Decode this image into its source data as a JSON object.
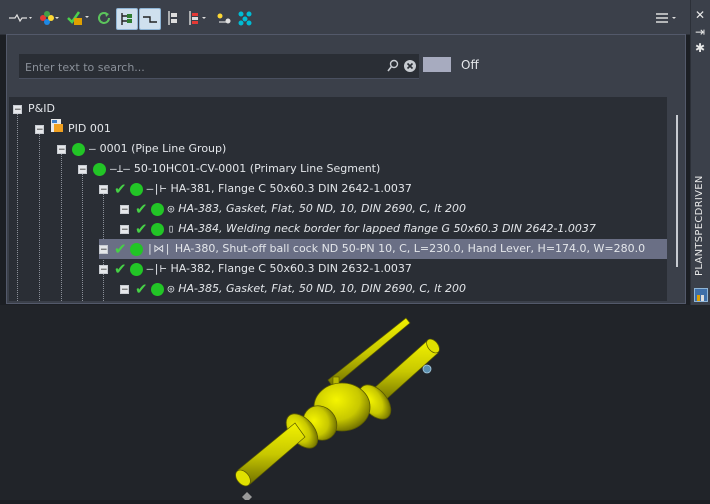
{
  "toolbar": {
    "icons": [
      "line-dropdown-icon",
      "color-dropdown-icon",
      "check-filter-icon",
      "refresh-icon",
      "tree-view-icon",
      "line-segment-icon",
      "hierarchy-icon",
      "hierarchy-dropdown-icon",
      "move-icon",
      "connect-icon",
      "menu-icon"
    ]
  },
  "side_panel": {
    "title": "PLANTSPECDRIVEN",
    "glyphs": [
      "✕",
      "⇥",
      "✱"
    ]
  },
  "search": {
    "placeholder": "Enter text to search...",
    "value": ""
  },
  "filter_toggle": {
    "label": "Off",
    "state": false
  },
  "tree": {
    "rows": [
      {
        "label": "P&ID"
      },
      {
        "label": "PID 001"
      },
      {
        "label": "0001 (Pipe Line Group)"
      },
      {
        "label": "50-10HC01-CV-0001 (Primary Line Segment)"
      },
      {
        "label": "HA-381, Flange C 50x60.3 DIN 2642-1.0037"
      },
      {
        "label": "HA-383, Gasket, Flat, 50 ND, 10, DIN 2690, C, lt 200"
      },
      {
        "label": "HA-384, Welding neck border for lapped flange G 50x60.3 DIN 2642-1.0037"
      },
      {
        "label": "HA-380, Shut-off ball cock ND 50-PN 10, C, L=230.0, Hand Lever, H=174.0, W=280.0"
      },
      {
        "label": "HA-382, Flange C 50x60.3 DIN 2632-1.0037"
      },
      {
        "label": "HA-385, Gasket, Flat, 50 ND, 10, DIN 2690, C, lt 200"
      }
    ],
    "selected_index": 7
  },
  "colors": {
    "status_green": "#22c526",
    "check_green": "#46d046",
    "selection": "#6a6f85",
    "model_yellow": "#c8c800"
  }
}
